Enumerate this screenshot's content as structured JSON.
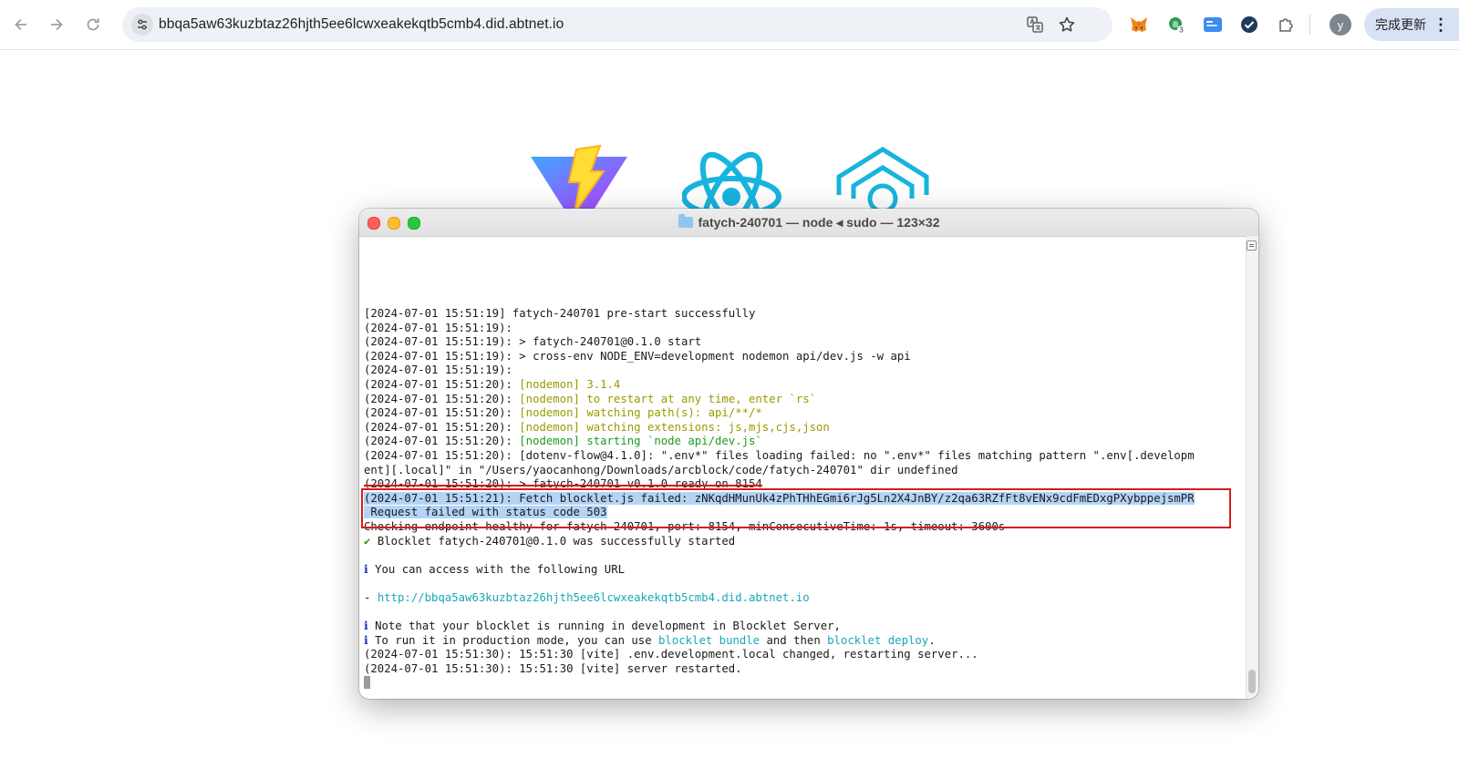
{
  "browser": {
    "url": "bbqa5aw63kuzbtaz26hjth5ee6lcwxeakekqtb5cmb4.did.abtnet.io",
    "avatar_letter": "y",
    "update_label": "完成更新",
    "menu_dots": "⋮",
    "extension_badge": "3",
    "icons": [
      "back-arrow-icon",
      "forward-arrow-icon",
      "reload-icon",
      "site-info-icon",
      "translate-icon",
      "star-icon",
      "metamask-fox-icon",
      "extension-icon",
      "extension-icon",
      "check-icon",
      "puzzle-icon",
      "menu-dots-icon"
    ]
  },
  "terminal": {
    "title": "fatych-240701 — node ◂ sudo — 123×32",
    "lines": [
      [
        {
          "t": "[2024-07-01 15:51:19] fatych-240701 pre-start successfully",
          "c": ""
        }
      ],
      [
        {
          "t": "(2024-07-01 15:51:19):",
          "c": ""
        }
      ],
      [
        {
          "t": "(2024-07-01 15:51:19): > fatych-240701@0.1.0 start",
          "c": ""
        }
      ],
      [
        {
          "t": "(2024-07-01 15:51:19): > cross-env NODE_ENV=development nodemon api/dev.js -w api",
          "c": ""
        }
      ],
      [
        {
          "t": "(2024-07-01 15:51:19):",
          "c": ""
        }
      ],
      [
        {
          "t": "(2024-07-01 15:51:20): ",
          "c": ""
        },
        {
          "t": "[nodemon] 3.1.4",
          "c": "c-y"
        }
      ],
      [
        {
          "t": "(2024-07-01 15:51:20): ",
          "c": ""
        },
        {
          "t": "[nodemon] to restart at any time, enter `rs`",
          "c": "c-y"
        }
      ],
      [
        {
          "t": "(2024-07-01 15:51:20): ",
          "c": ""
        },
        {
          "t": "[nodemon] watching path(s): api/**/*",
          "c": "c-y"
        }
      ],
      [
        {
          "t": "(2024-07-01 15:51:20): ",
          "c": ""
        },
        {
          "t": "[nodemon] watching extensions: js,mjs,cjs,json",
          "c": "c-y"
        }
      ],
      [
        {
          "t": "(2024-07-01 15:51:20): ",
          "c": ""
        },
        {
          "t": "[nodemon] starting `node api/dev.js`",
          "c": "c-g"
        }
      ],
      [
        {
          "t": "(2024-07-01 15:51:20): [dotenv-flow@4.1.0]: \".env*\" files loading failed: no \".env*\" files matching pattern \".env[.developm",
          "c": ""
        }
      ],
      [
        {
          "t": "ent][.local]\" in \"/Users/yaocanhong/Downloads/arcblock/code/fatych-240701\" dir undefined",
          "c": ""
        }
      ],
      [
        {
          "t": "(2024-07-01 15:51:20): > fatych-240701 v0.1.0 ready on 8154",
          "c": "strike"
        }
      ],
      [
        {
          "t": "(2024-07-01 15:51:21): Fetch blocklet.js failed: zNKqdHMunUk4zPhTHhEGmi6rJg5Ln2X4JnBY/z2qa63RZfFt8vENx9cdFmEDxgPXybppejsmPR",
          "c": "sel"
        }
      ],
      [
        {
          "t": " Request failed with status code 503",
          "c": "sel"
        }
      ],
      [
        {
          "t": "Checking endpoint healthy for fatych-240701, port: 8154, minConsecutiveTime: 1s, timeout: 3600s",
          "c": "strike"
        }
      ],
      [
        {
          "t": "✔ ",
          "c": "c-g"
        },
        {
          "t": "Blocklet fatych-240701@0.1.0 was successfully started",
          "c": ""
        }
      ],
      [
        {
          "t": "",
          "c": ""
        }
      ],
      [
        {
          "t": "ℹ ",
          "c": "c-b"
        },
        {
          "t": "You can access with the following URL",
          "c": ""
        }
      ],
      [
        {
          "t": "",
          "c": ""
        }
      ],
      [
        {
          "t": "- ",
          "c": ""
        },
        {
          "t": "http://bbqa5aw63kuzbtaz26hjth5ee6lcwxeakekqtb5cmb4.did.abtnet.io",
          "c": "c-c"
        }
      ],
      [
        {
          "t": "",
          "c": ""
        }
      ],
      [
        {
          "t": "ℹ ",
          "c": "c-b"
        },
        {
          "t": "Note that your blocklet is running in development in Blocklet Server,",
          "c": ""
        }
      ],
      [
        {
          "t": "ℹ ",
          "c": "c-b"
        },
        {
          "t": "To run it in production mode, you can use ",
          "c": ""
        },
        {
          "t": "blocklet bundle",
          "c": "c-c"
        },
        {
          "t": " and then ",
          "c": ""
        },
        {
          "t": "blocklet deploy",
          "c": "c-c"
        },
        {
          "t": ".",
          "c": ""
        }
      ],
      [
        {
          "t": "(2024-07-01 15:51:30): 15:51:30 [vite] .env.development.local changed, restarting server...",
          "c": ""
        }
      ],
      [
        {
          "t": "(2024-07-01 15:51:30): 15:51:30 [vite] server restarted.",
          "c": ""
        }
      ]
    ]
  },
  "colors": {
    "yellow": "#9a9a00",
    "green": "#1f9a1f",
    "cyan": "#18a8b8",
    "blue": "#1a33c4",
    "selection": "#b4d4f6",
    "highlight_border": "#d91b1b"
  }
}
